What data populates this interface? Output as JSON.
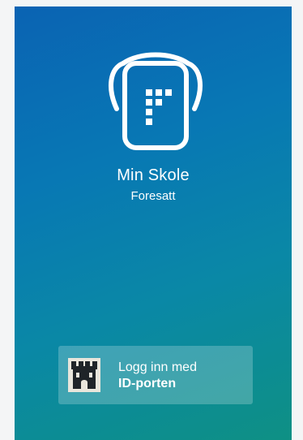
{
  "app": {
    "title": "Min Skole",
    "subtitle": "Foresatt",
    "logo_icon": "backpack-logo-icon"
  },
  "login": {
    "line1": "Logg inn med",
    "line2": "ID-porten",
    "icon": "id-porten-castle-icon"
  },
  "colors": {
    "gradient_top": "#0a63b3",
    "gradient_bottom": "#0e9084",
    "text": "#ffffff"
  }
}
